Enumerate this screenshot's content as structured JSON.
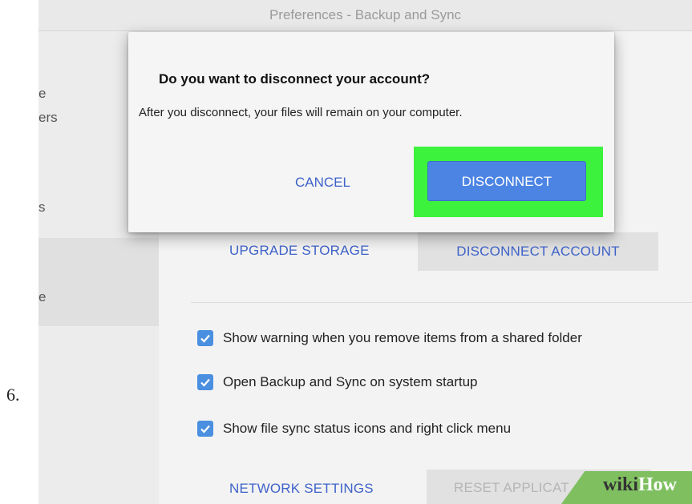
{
  "step_number": "6.",
  "window": {
    "title": "Preferences - Backup and Sync"
  },
  "sidebar": {
    "items": [
      {
        "label": "e"
      },
      {
        "label": "ers"
      },
      {
        "label": "s"
      },
      {
        "label": "e"
      }
    ]
  },
  "account": {
    "upgrade_label": "UPGRADE STORAGE",
    "disconnect_account_label": "DISCONNECT ACCOUNT"
  },
  "options": [
    {
      "label": "Show warning when you remove items from a shared folder",
      "checked": true
    },
    {
      "label": "Open Backup and Sync on system startup",
      "checked": true
    },
    {
      "label": "Show file sync status icons and right click menu",
      "checked": true
    }
  ],
  "footer": {
    "network_label": "NETWORK SETTINGS",
    "reset_label": "RESET APPLICAT"
  },
  "dialog": {
    "title": "Do you want to disconnect your account?",
    "body": "After you disconnect, your files will remain on your computer.",
    "cancel_label": "CANCEL",
    "confirm_label": "DISCONNECT"
  },
  "watermark": {
    "part1": "wiki",
    "part2": "How"
  },
  "colors": {
    "accent": "#3f63c9",
    "primary_button": "#4c84e4",
    "highlight": "#3cf23c",
    "checkbox": "#4a8fe0"
  }
}
